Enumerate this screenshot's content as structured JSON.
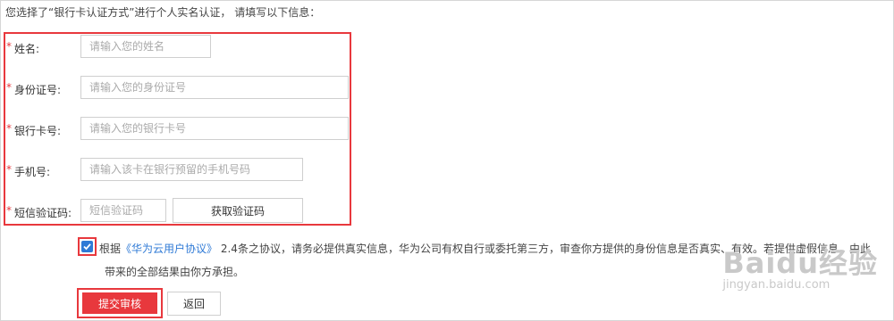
{
  "intro": "您选择了“银行卡认证方式”进行个人实名认证，  请填写以下信息：",
  "form": {
    "required_mark": "*",
    "fields": [
      {
        "label": "姓名:",
        "placeholder": "请输入您的姓名"
      },
      {
        "label": "身份证号:",
        "placeholder": "请输入您的身份证号"
      },
      {
        "label": "银行卡号:",
        "placeholder": "请输入您的银行卡号"
      },
      {
        "label": "手机号:",
        "placeholder": "请输入该卡在银行预留的手机号码"
      },
      {
        "label": "短信验证码:",
        "placeholder": "短信验证码"
      }
    ],
    "get_code_label": "获取验证码"
  },
  "agreement": {
    "checked": true,
    "prefix": "根据",
    "link_text": "《华为云用户协议》",
    "line1_rest": "2.4条之协议，请务必提供真实信息，华为公司有权自行或委托第三方，审查你方提供的身份信息是否真实、有效。若提供虚假信息，由此",
    "line2": "带来的全部结果由你方承担。"
  },
  "buttons": {
    "submit": "提交审核",
    "back": "返回"
  },
  "watermark": {
    "logo": "Baidu经验",
    "url": "jingyan.baidu.com"
  },
  "colors": {
    "accent_red": "#e8383d",
    "link_blue": "#2f7ad6"
  }
}
